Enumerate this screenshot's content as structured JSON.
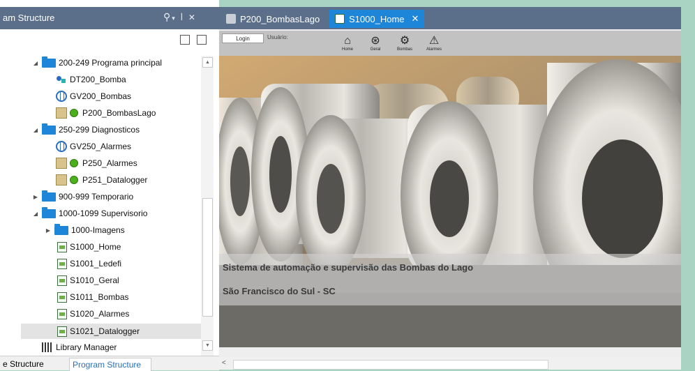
{
  "left_panel": {
    "title": "am Structure",
    "tree": [
      {
        "label": "200-249 Programa principal",
        "type": "folder",
        "expanded": true
      },
      {
        "label": "DT200_Bomba",
        "type": "datatype"
      },
      {
        "label": "GV200_Bombas",
        "type": "globalvars"
      },
      {
        "label": "P200_BombasLago",
        "type": "program"
      },
      {
        "label": "250-299 Diagnosticos",
        "type": "folder",
        "expanded": true
      },
      {
        "label": "GV250_Alarmes",
        "type": "globalvars"
      },
      {
        "label": "P250_Alarmes",
        "type": "program"
      },
      {
        "label": "P251_Datalogger",
        "type": "program"
      },
      {
        "label": "900-999 Temporario",
        "type": "folder",
        "expanded": false
      },
      {
        "label": "1000-1099 Supervisorio",
        "type": "folder",
        "expanded": true
      },
      {
        "label": "1000-Imagens",
        "type": "folder",
        "expanded": false
      },
      {
        "label": "S1000_Home",
        "type": "screen"
      },
      {
        "label": "S1001_Ledefi",
        "type": "screen"
      },
      {
        "label": "S1010_Geral",
        "type": "screen"
      },
      {
        "label": "S1011_Bombas",
        "type": "screen"
      },
      {
        "label": "S1020_Alarmes",
        "type": "screen"
      },
      {
        "label": "S1021_Datalogger",
        "type": "screen",
        "selected": true
      },
      {
        "label": "Library Manager",
        "type": "library"
      }
    ],
    "bottom_tabs": [
      "e Structure",
      "Program Structure"
    ]
  },
  "doc_tabs": [
    {
      "label": "P200_BombasLago",
      "active": false
    },
    {
      "label": "S1000_Home",
      "active": true,
      "close": "✕"
    }
  ],
  "hmi": {
    "login_label": "Login",
    "user_label": "Usuário:",
    "nav": [
      {
        "label": "Home",
        "icon": "home-icon",
        "glyph": "⌂"
      },
      {
        "label": "Geral",
        "icon": "binoculars-icon",
        "glyph": "⊛"
      },
      {
        "label": "Bombas",
        "icon": "gears-icon",
        "glyph": "⚙"
      },
      {
        "label": "Alarmes",
        "icon": "warning-icon",
        "glyph": "⚠"
      }
    ],
    "caption_line1": "Sistema de automação e supervisão das Bombas do Lago",
    "caption_line2": "São Francisco do Sul - SC"
  },
  "colors": {
    "title_bar": "#5b6f8a",
    "active_tab": "#1e86d9",
    "folder": "#1e86d9",
    "selection": "#e3e3e3"
  }
}
